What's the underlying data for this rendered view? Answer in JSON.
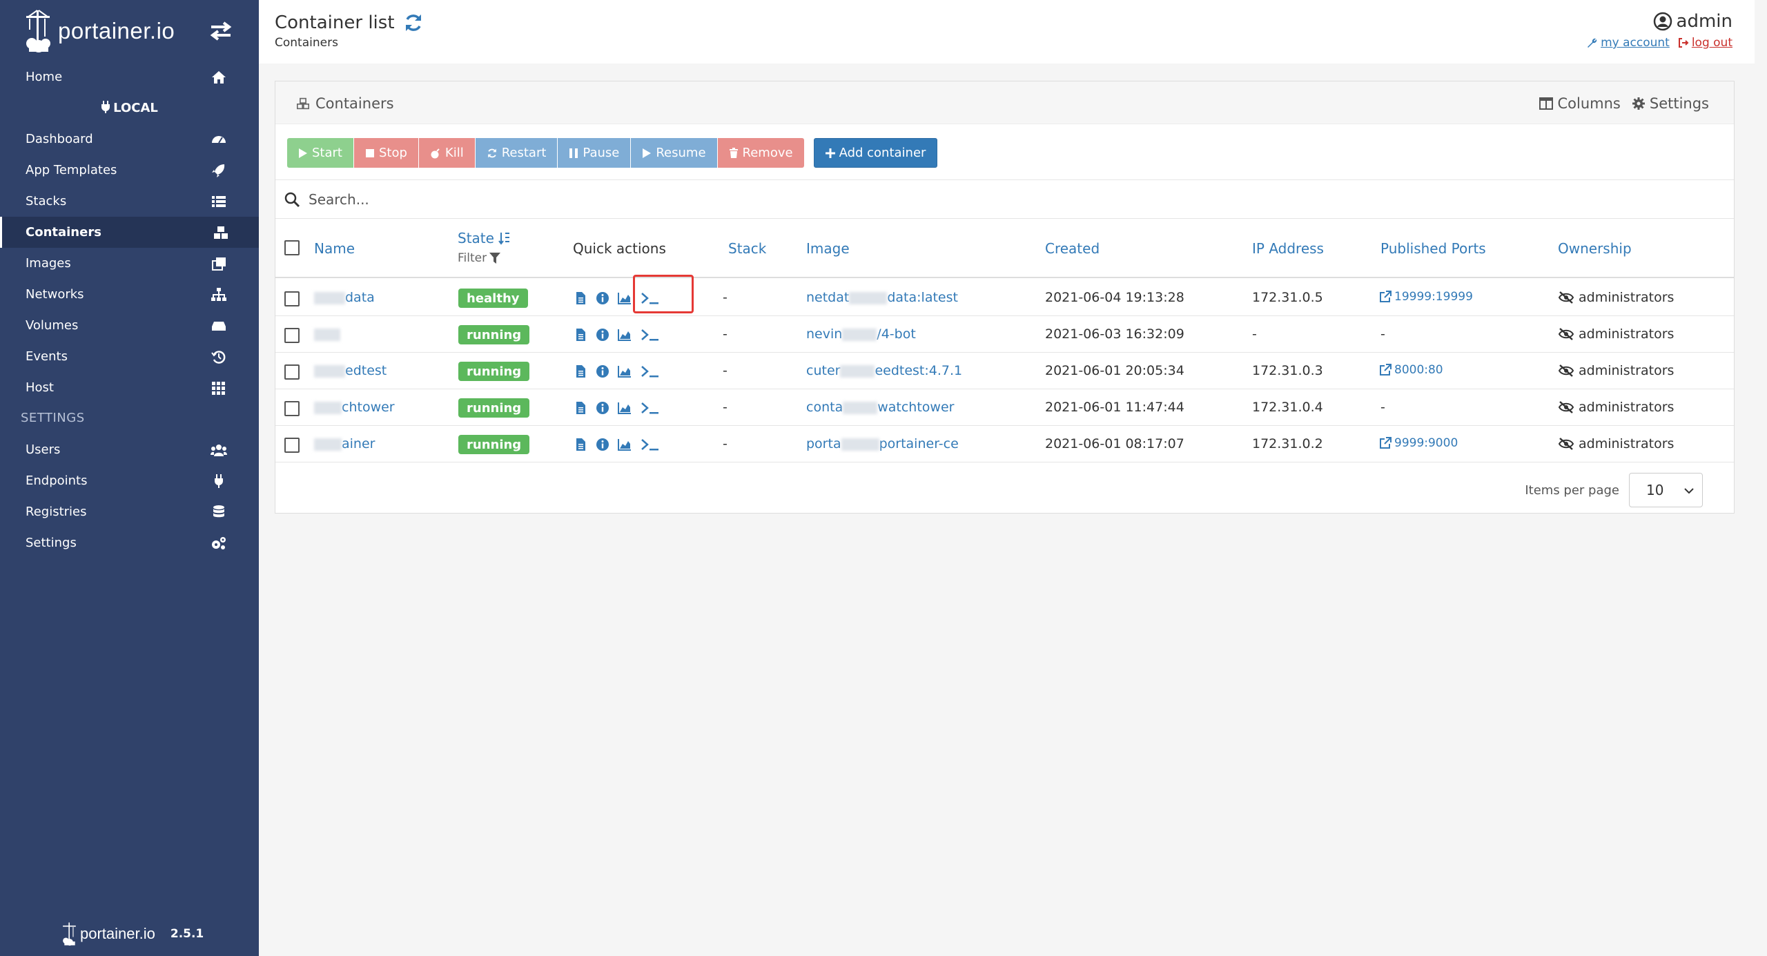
{
  "sidebar": {
    "logo_text": "portainer.io",
    "endpoint_label": "LOCAL",
    "settings_header": "SETTINGS",
    "items": [
      {
        "label": "Home"
      },
      {
        "label": "Dashboard"
      },
      {
        "label": "App Templates"
      },
      {
        "label": "Stacks"
      },
      {
        "label": "Containers"
      },
      {
        "label": "Images"
      },
      {
        "label": "Networks"
      },
      {
        "label": "Volumes"
      },
      {
        "label": "Events"
      },
      {
        "label": "Host"
      }
    ],
    "settings_items": [
      {
        "label": "Users"
      },
      {
        "label": "Endpoints"
      },
      {
        "label": "Registries"
      },
      {
        "label": "Settings"
      }
    ],
    "footer_text": "portainer.io",
    "version": "2.5.1"
  },
  "header": {
    "title": "Container list",
    "breadcrumb": "Containers",
    "user": "admin",
    "my_account": "my account",
    "log_out": "log out"
  },
  "panel": {
    "title": "Containers",
    "columns_label": "Columns",
    "settings_label": "Settings"
  },
  "actions": {
    "start": "Start",
    "stop": "Stop",
    "kill": "Kill",
    "restart": "Restart",
    "pause": "Pause",
    "resume": "Resume",
    "remove": "Remove",
    "add": "Add container"
  },
  "search": {
    "placeholder": "Search..."
  },
  "table": {
    "headers": {
      "name": "Name",
      "state": "State",
      "state_filter": "Filter",
      "quick_actions": "Quick actions",
      "stack": "Stack",
      "image": "Image",
      "created": "Created",
      "ip": "IP Address",
      "ports": "Published Ports",
      "ownership": "Ownership"
    },
    "rows": [
      {
        "name": "data",
        "state": "healthy",
        "stack": "-",
        "image_a": "netdat",
        "image_b": "data:latest",
        "created": "2021-06-04 19:13:28",
        "ip": "172.31.0.5",
        "port": "19999:19999",
        "owner": "administrators"
      },
      {
        "name": "",
        "state": "running",
        "stack": "-",
        "image_a": "nevin",
        "image_b": "/4-bot",
        "created": "2021-06-03 16:32:09",
        "ip": "-",
        "port": "-",
        "owner": "administrators"
      },
      {
        "name": "edtest",
        "state": "running",
        "stack": "-",
        "image_a": "cuter",
        "image_b": "eedtest:4.7.1",
        "created": "2021-06-01 20:05:34",
        "ip": "172.31.0.3",
        "port": "8000:80",
        "owner": "administrators"
      },
      {
        "name": "chtower",
        "state": "running",
        "stack": "-",
        "image_a": "conta",
        "image_b": "watchtower",
        "created": "2021-06-01 11:47:44",
        "ip": "172.31.0.4",
        "port": "-",
        "owner": "administrators"
      },
      {
        "name": "ainer",
        "state": "running",
        "stack": "-",
        "image_a": "porta",
        "image_b": "portainer-ce",
        "created": "2021-06-01 08:17:07",
        "ip": "172.31.0.2",
        "port": "9999:9000",
        "owner": "administrators"
      }
    ]
  },
  "pagination": {
    "label": "Items per page",
    "value": "10"
  },
  "colors": {
    "sidebar": "#30426a",
    "primary": "#337ab7",
    "success": "#5cb85c",
    "danger": "#d9534f"
  }
}
